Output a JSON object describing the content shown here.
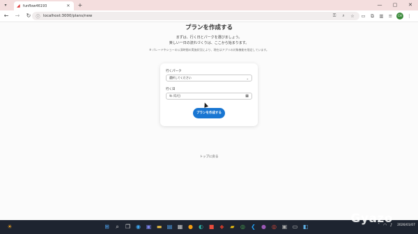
{
  "browser": {
    "tab_title": "funflow46193",
    "new_tab_icon": "+",
    "url": "localhost:3000/plans/new",
    "window_controls": [
      "—",
      "▢",
      "✕"
    ]
  },
  "page": {
    "title": "プランを作成する",
    "subtitle_line1": "まずは、行く日とパークを選びましょう。",
    "subtitle_line2": "楽しい一日の流れづくりは、ここから始まります。",
    "notice": "※ パレードやショーの公演時間の実施状況により、現在はアプリの対象機能を限定しています。",
    "park_label": "行くパーク",
    "park_select_value": "選択してください",
    "date_label": "行く日",
    "date_value": "年 /月/日",
    "submit_label": "プランを作成する",
    "back_link": "トップに戻る"
  },
  "taskbar": {
    "clock_time": "",
    "clock_date": "2026/01/07",
    "watermark": "Gyazo"
  },
  "colors": {
    "accent": "#1976d2",
    "tabbar": "#f4dede",
    "taskbar": "#1e2430"
  }
}
